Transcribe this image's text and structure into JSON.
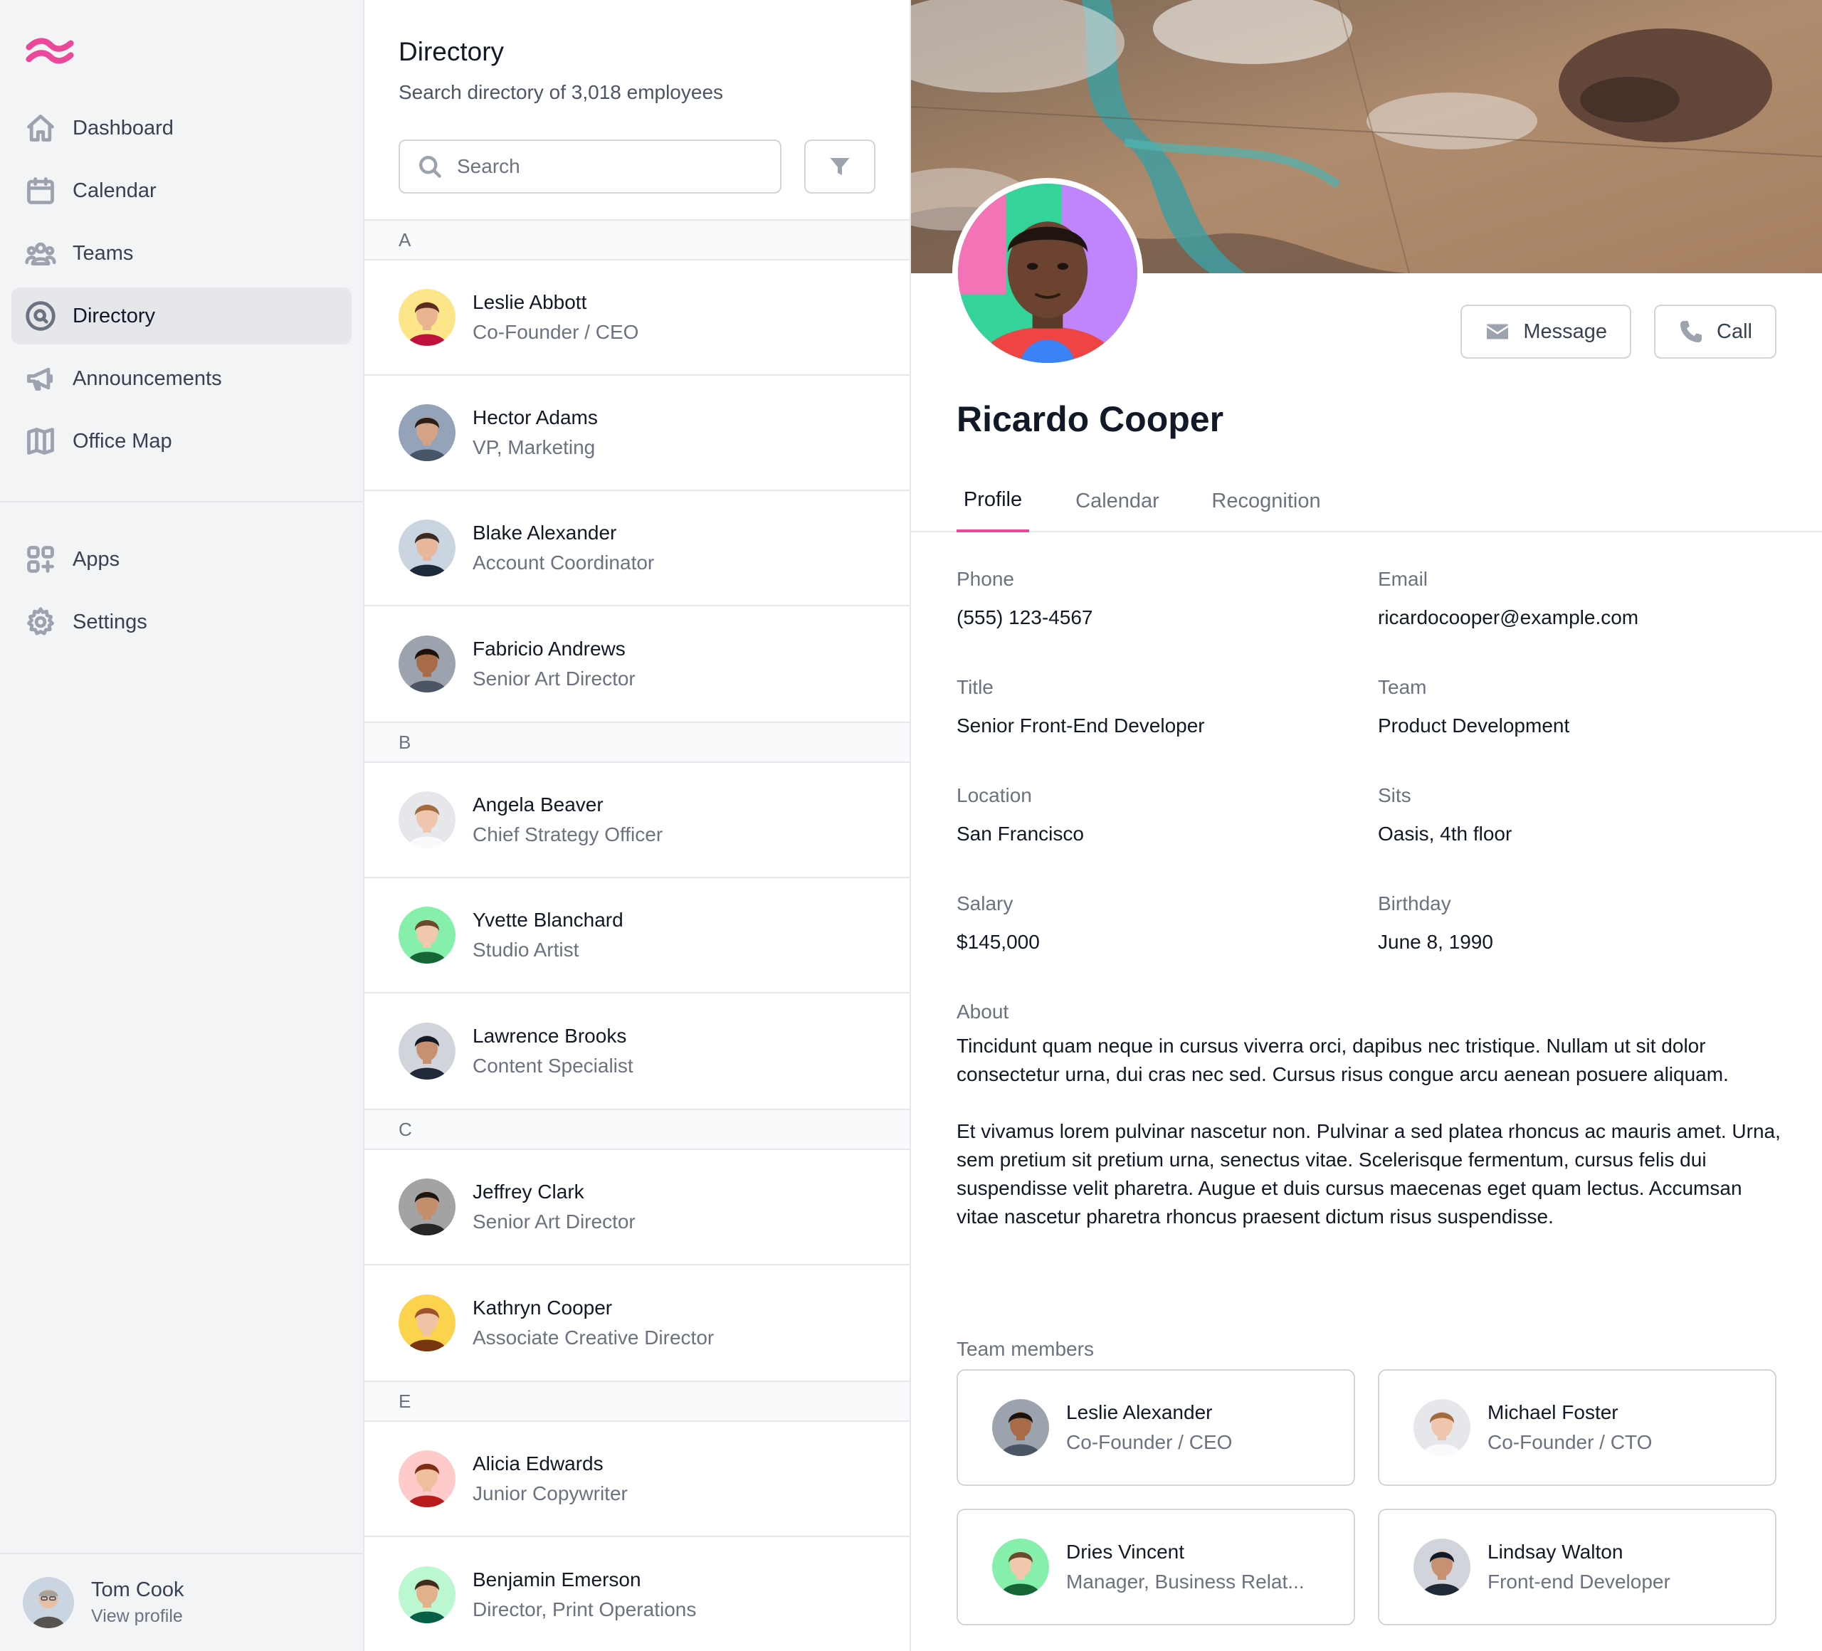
{
  "sidebar": {
    "nav": [
      {
        "label": "Dashboard",
        "icon": "home-icon"
      },
      {
        "label": "Calendar",
        "icon": "calendar-icon"
      },
      {
        "label": "Teams",
        "icon": "users-icon"
      },
      {
        "label": "Directory",
        "icon": "search-circle-icon",
        "active": true
      },
      {
        "label": "Announcements",
        "icon": "megaphone-icon"
      },
      {
        "label": "Office Map",
        "icon": "map-icon"
      }
    ],
    "secondary": [
      {
        "label": "Apps",
        "icon": "apps-icon"
      },
      {
        "label": "Settings",
        "icon": "gear-icon"
      }
    ],
    "user": {
      "name": "Tom Cook",
      "link": "View profile"
    }
  },
  "directory": {
    "title": "Directory",
    "subtitle": "Search directory of 3,018 employees",
    "search_placeholder": "Search",
    "groups": [
      {
        "letter": "A",
        "people": [
          {
            "name": "Leslie Abbott",
            "role": "Co-Founder / CEO"
          },
          {
            "name": "Hector Adams",
            "role": "VP, Marketing"
          },
          {
            "name": "Blake Alexander",
            "role": "Account Coordinator"
          },
          {
            "name": "Fabricio Andrews",
            "role": "Senior Art Director"
          }
        ]
      },
      {
        "letter": "B",
        "people": [
          {
            "name": "Angela Beaver",
            "role": "Chief Strategy Officer"
          },
          {
            "name": "Yvette Blanchard",
            "role": "Studio Artist"
          },
          {
            "name": "Lawrence Brooks",
            "role": "Content Specialist"
          }
        ]
      },
      {
        "letter": "C",
        "people": [
          {
            "name": "Jeffrey Clark",
            "role": "Senior Art Director"
          },
          {
            "name": "Kathryn Cooper",
            "role": "Associate Creative Director"
          }
        ]
      },
      {
        "letter": "E",
        "people": [
          {
            "name": "Alicia Edwards",
            "role": "Junior Copywriter"
          },
          {
            "name": "Benjamin Emerson",
            "role": "Director, Print Operations"
          }
        ]
      }
    ]
  },
  "profile": {
    "name": "Ricardo Cooper",
    "actions": {
      "message": "Message",
      "call": "Call"
    },
    "tabs": [
      "Profile",
      "Calendar",
      "Recognition"
    ],
    "active_tab": "Profile",
    "fields": {
      "phone": {
        "label": "Phone",
        "value": "(555) 123-4567"
      },
      "email": {
        "label": "Email",
        "value": "ricardocooper@example.com"
      },
      "title": {
        "label": "Title",
        "value": "Senior Front-End Developer"
      },
      "team": {
        "label": "Team",
        "value": "Product Development"
      },
      "location": {
        "label": "Location",
        "value": "San Francisco"
      },
      "sits": {
        "label": "Sits",
        "value": "Oasis, 4th floor"
      },
      "salary": {
        "label": "Salary",
        "value": "$145,000"
      },
      "birthday": {
        "label": "Birthday",
        "value": "June 8, 1990"
      }
    },
    "about": {
      "label": "About",
      "paragraphs": [
        "Tincidunt quam neque in cursus viverra orci, dapibus nec tristique. Nullam ut sit dolor consectetur urna, dui cras nec sed. Cursus risus congue arcu aenean posuere aliquam.",
        "Et vivamus lorem pulvinar nascetur non. Pulvinar a sed platea rhoncus ac mauris amet. Urna, sem pretium sit pretium urna, senectus vitae. Scelerisque fermentum, cursus felis dui suspendisse velit pharetra. Augue et duis cursus maecenas eget quam lectus. Accumsan vitae nascetur pharetra rhoncus praesent dictum risus suspendisse."
      ]
    },
    "team_members": {
      "label": "Team members",
      "members": [
        {
          "name": "Leslie Alexander",
          "role": "Co-Founder / CEO"
        },
        {
          "name": "Michael Foster",
          "role": "Co-Founder / CTO"
        },
        {
          "name": "Dries Vincent",
          "role": "Manager, Business Relat..."
        },
        {
          "name": "Lindsay Walton",
          "role": "Front-end Developer"
        }
      ]
    }
  },
  "colors": {
    "accent": "#ec4899",
    "sidebar_bg": "#f3f4f6",
    "active_nav_bg": "#e5e7eb",
    "border": "#e5e7eb"
  }
}
